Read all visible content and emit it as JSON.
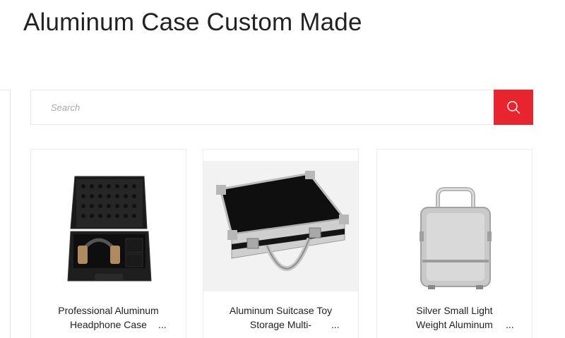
{
  "page": {
    "title": "Aluminum Case Custom Made"
  },
  "search": {
    "placeholder": "Search",
    "value": "",
    "button_icon": "search-icon"
  },
  "colors": {
    "accent": "#e8242f",
    "border": "#e6e6e6",
    "title_text": "#222222"
  },
  "products": [
    {
      "title_line1": "Professional Aluminum",
      "title_line2": "Headphone Case",
      "ellipsis": "...",
      "image": "black-headphone-case-image"
    },
    {
      "title_line1": "Aluminum Suitcase Toy",
      "title_line2": "Storage Multi-",
      "ellipsis": "...",
      "image": "black-aluminum-suitcase-image"
    },
    {
      "title_line1": "Silver Small Light",
      "title_line2": "Weight Aluminum",
      "ellipsis": "...",
      "image": "silver-small-case-image"
    }
  ]
}
